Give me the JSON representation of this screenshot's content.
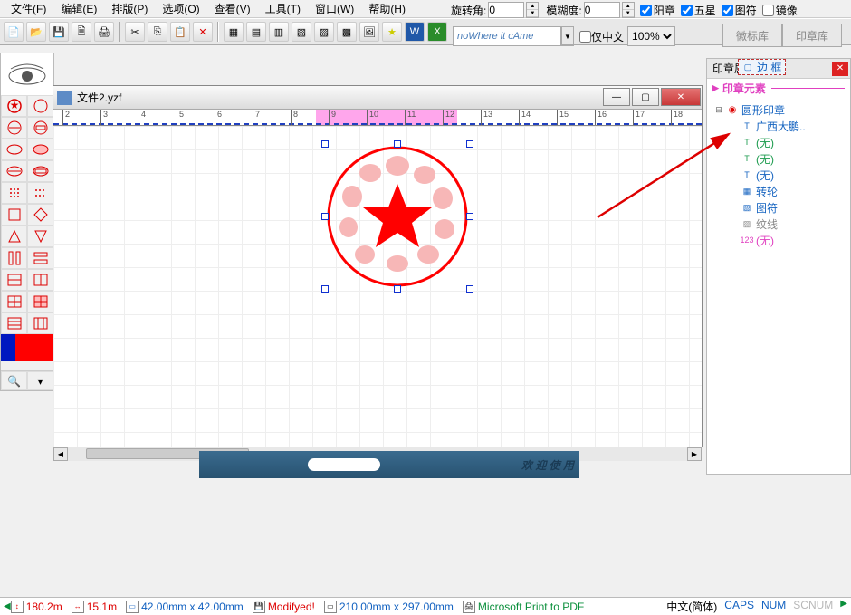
{
  "menu": {
    "file": "文件(F)",
    "edit": "编辑(E)",
    "layout": "排版(P)",
    "options": "选项(O)",
    "view": "查看(V)",
    "tools": "工具(T)",
    "window": "窗口(W)",
    "help": "帮助(H)"
  },
  "top": {
    "rotate_label": "旋转角:",
    "rotate_val": "0",
    "blur_label": "模糊度:",
    "blur_val": "0",
    "cb_yang": "阳章",
    "cb_star": "五星",
    "cb_tufu": "图符",
    "cb_mirror": "镜像"
  },
  "fontpreview": "noWhere  it  cAme",
  "cn_only": "仅中文",
  "zoom": "100%",
  "tabs": {
    "badge": "徽标库",
    "stamp": "印章库"
  },
  "doc_title": "文件2.yzf",
  "ruler_ticks": [
    "2",
    "3",
    "4",
    "5",
    "6",
    "7",
    "8",
    "9",
    "10",
    "11",
    "12",
    "13",
    "14",
    "15",
    "16",
    "17",
    "18"
  ],
  "rpanel": {
    "title": "印章属性",
    "section": "印章元素",
    "root": "圆形印章",
    "items": [
      {
        "icon": "rect",
        "label": "边 框",
        "sel": true,
        "color": "#1664c0"
      },
      {
        "icon": "T",
        "label": "广西大鹏..",
        "color": "#1664c0"
      },
      {
        "icon": "T",
        "label": "(无)",
        "color": "#1a9a4c"
      },
      {
        "icon": "T",
        "label": "(无)",
        "color": "#1a9a4c"
      },
      {
        "icon": "T",
        "label": "(无)",
        "color": "#1664c0"
      },
      {
        "icon": "grid",
        "label": "转轮",
        "color": "#1664c0"
      },
      {
        "icon": "pic",
        "label": "图符",
        "color": "#1664c0"
      },
      {
        "icon": "hatch",
        "label": "纹线",
        "color": "#888"
      },
      {
        "icon": "123",
        "label": "(无)",
        "color": "#e040c0"
      }
    ]
  },
  "banner_text": "欢 迎 使 用",
  "status": {
    "v1": "180.2m",
    "v2": "15.1m",
    "v3": "42.00mm x 42.00mm",
    "mod": "Modifyed!",
    "paper": "210.00mm x 297.00mm",
    "printer": "Microsoft Print to PDF",
    "ime": "中文(简体)",
    "caps": "CAPS",
    "num": "NUM",
    "scr": "SCNUM"
  }
}
